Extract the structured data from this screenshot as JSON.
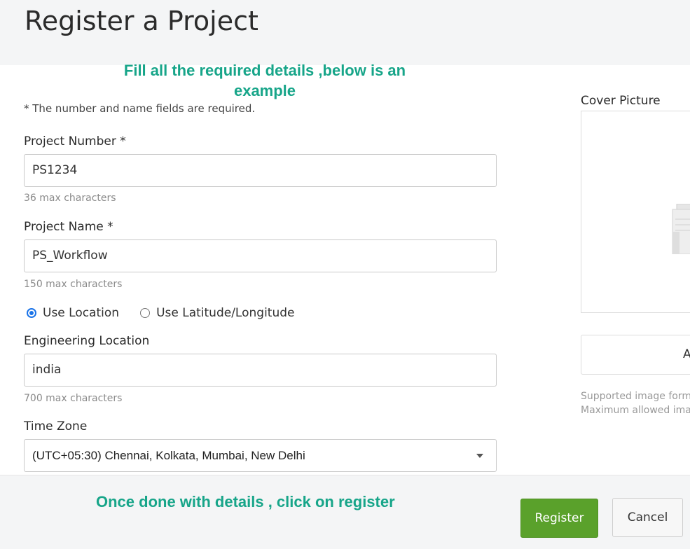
{
  "page": {
    "title": "Register a Project",
    "required_note": "* The number and name fields are required."
  },
  "annotations": {
    "top": "Fill all the required details ,below is an example",
    "bottom": "Once done with details , click on register",
    "color": "#17a589"
  },
  "form": {
    "project_number": {
      "label": "Project Number *",
      "value": "PS1234",
      "hint": "36 max characters"
    },
    "project_name": {
      "label": "Project Name *",
      "value": "PS_Workflow",
      "hint": "150 max characters"
    },
    "location_mode": {
      "options": [
        "Use Location",
        "Use Latitude/Longitude"
      ],
      "selected": "Use Location"
    },
    "engineering_location": {
      "label": "Engineering Location",
      "value": "india",
      "hint": "700 max characters"
    },
    "time_zone": {
      "label": "Time Zone",
      "value": "(UTC+05:30) Chennai, Kolkata, Mumbai, New Delhi"
    }
  },
  "cover": {
    "label": "Cover Picture",
    "add_button_partial": "A",
    "support_line1": "Supported image form",
    "support_line2": "Maximum allowed ima",
    "placeholder_icon": "building-icon"
  },
  "footer": {
    "register_label": "Register",
    "cancel_label": "Cancel",
    "register_color": "#5aa12b"
  }
}
